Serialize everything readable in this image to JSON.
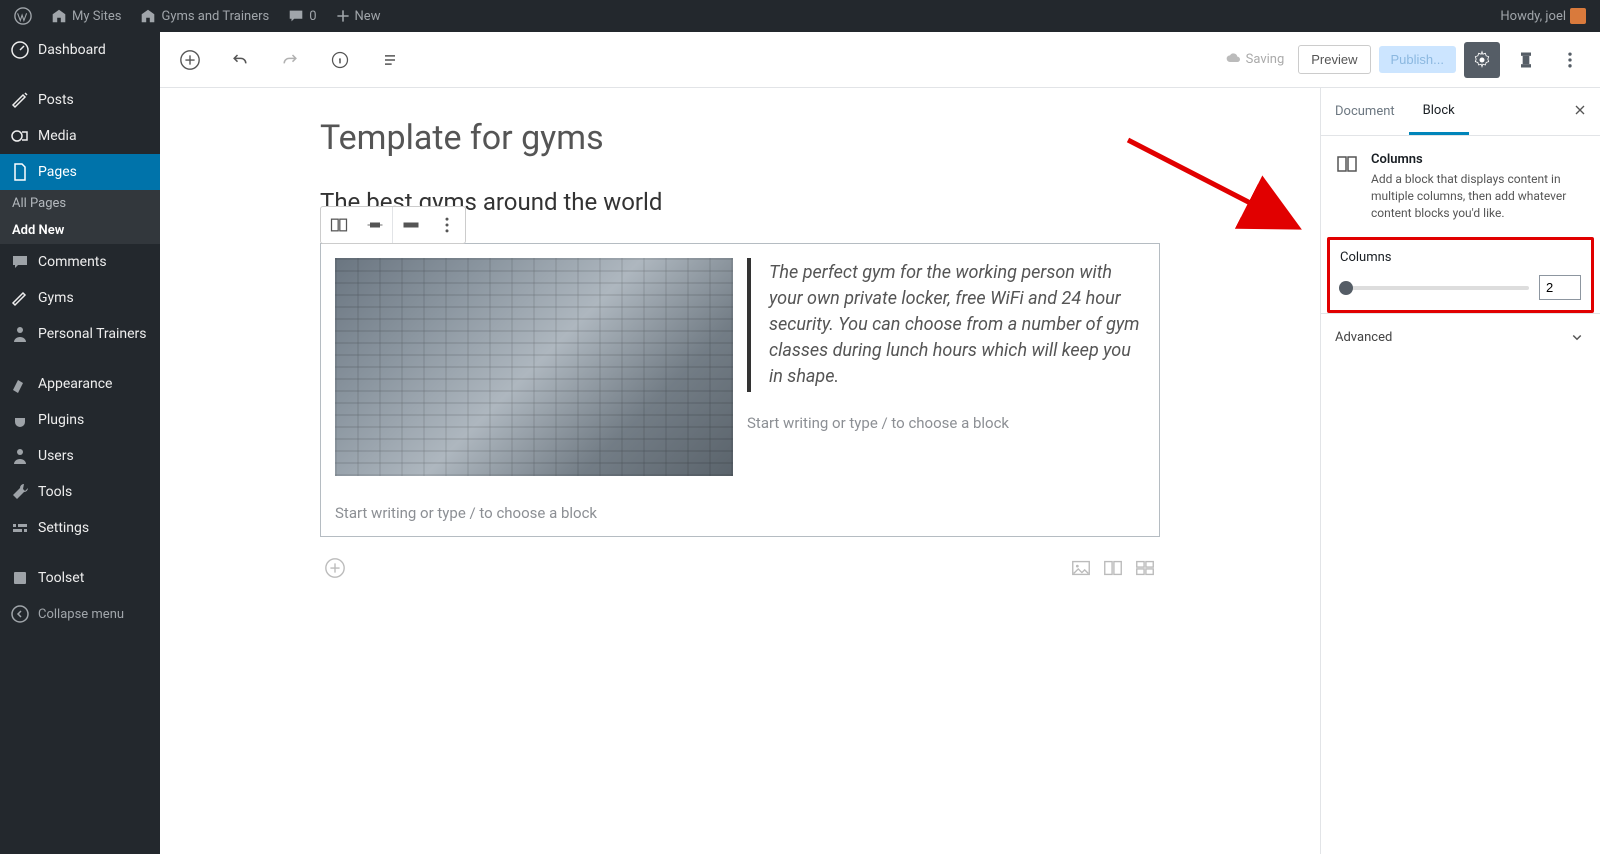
{
  "adminbar": {
    "mysites": "My Sites",
    "sitename": "Gyms and Trainers",
    "comments": "0",
    "new": "New",
    "howdy": "Howdy, joel"
  },
  "sidebar": {
    "dashboard": "Dashboard",
    "posts": "Posts",
    "media": "Media",
    "pages": "Pages",
    "all_pages": "All Pages",
    "add_new": "Add New",
    "comments": "Comments",
    "gyms": "Gyms",
    "trainers": "Personal Trainers",
    "appearance": "Appearance",
    "plugins": "Plugins",
    "users": "Users",
    "tools": "Tools",
    "settings": "Settings",
    "toolset": "Toolset",
    "collapse": "Collapse menu"
  },
  "topbar": {
    "saving": "Saving",
    "preview": "Preview",
    "publish": "Publish..."
  },
  "editor": {
    "title": "Template for gyms",
    "subtitle": "The best gyms around the world",
    "quote": "The perfect gym for the working person with your own private locker, free WiFi and 24 hour security. You can choose from a number of gym classes during lunch hours which will keep you in shape.",
    "placeholder": "Start writing or type / to choose a block"
  },
  "panel": {
    "tab_document": "Document",
    "tab_block": "Block",
    "block_name": "Columns",
    "block_desc": "Add a block that displays content in multiple columns, then add whatever content blocks you'd like.",
    "columns_label": "Columns",
    "columns_value": "2",
    "advanced": "Advanced"
  }
}
